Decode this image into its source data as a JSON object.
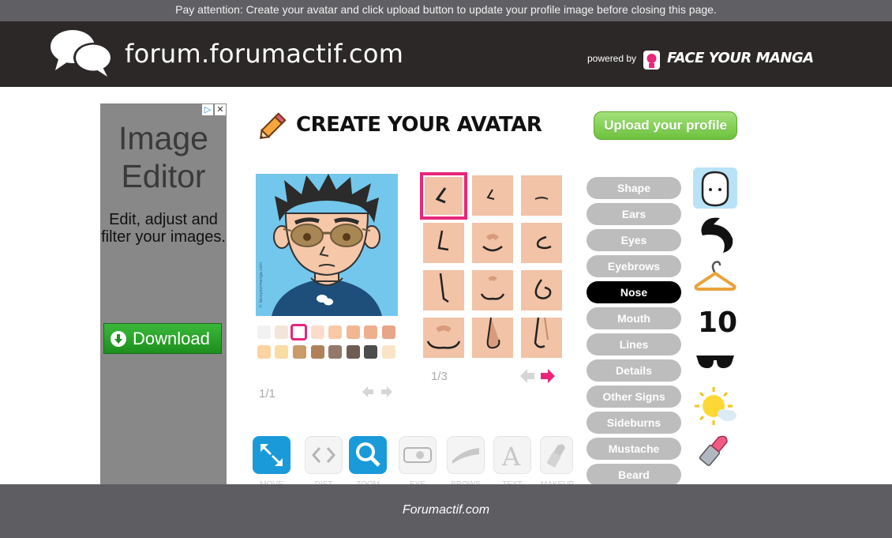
{
  "notice": "Pay attention: Create your avatar and click upload button to update your profile image before closing this page.",
  "header": {
    "site_title": "forum.forumactif.com",
    "powered_by": "powered by",
    "brand": "FACE YOUR MANGA"
  },
  "ad": {
    "title_line1": "Image",
    "title_line2": "Editor",
    "description": "Edit, adjust and filter your images.",
    "download_label": "Download"
  },
  "editor": {
    "title": "CREATE YOUR AVATAR",
    "upload_label": "Upload your profile",
    "left_page": "1/1",
    "right_page": "1/3"
  },
  "skin_swatches": [
    "#f1f1f1",
    "#f3e6d8",
    "#ffffff",
    "#fbdccb",
    "#f9c9a6",
    "#f2b693",
    "#eeaf8e",
    "#e8a58a",
    "#fbd4a2",
    "#f8dca3",
    "#c89b69",
    "#b08058",
    "#93786a",
    "#6f5c52",
    "#4d4d4d",
    "#fae4c8"
  ],
  "categories": [
    {
      "label": "Shape",
      "active": false
    },
    {
      "label": "Ears",
      "active": false
    },
    {
      "label": "Eyes",
      "active": false
    },
    {
      "label": "Eyebrows",
      "active": false
    },
    {
      "label": "Nose",
      "active": true
    },
    {
      "label": "Mouth",
      "active": false
    },
    {
      "label": "Lines",
      "active": false
    },
    {
      "label": "Details",
      "active": false
    },
    {
      "label": "Other Signs",
      "active": false
    },
    {
      "label": "Sideburns",
      "active": false
    },
    {
      "label": "Mustache",
      "active": false
    },
    {
      "label": "Beard",
      "active": false
    }
  ],
  "side_icons": [
    "face-shape-icon",
    "hair-icon",
    "hanger-icon",
    "number-10-icon",
    "sunglasses-icon",
    "sun-cloud-icon",
    "lipstick-icon"
  ],
  "tools": [
    {
      "name": "resize-tool",
      "label": "MOVE",
      "active": true
    },
    {
      "name": "distance-tool",
      "label": "DIST",
      "active": false
    },
    {
      "name": "zoom-tool",
      "label": "ZOOM",
      "active": true
    },
    {
      "name": "eye-tool",
      "label": "EYE",
      "active": false
    },
    {
      "name": "eyebrow-tool",
      "label": "BROWS",
      "active": false
    },
    {
      "name": "text-tool",
      "label": "TEXT",
      "active": false
    },
    {
      "name": "makeup-tool",
      "label": "MAKEUP",
      "active": false
    }
  ],
  "footer": "Forumactif.com",
  "colors": {
    "accent_pink": "#e8267a",
    "upload_green": "#6cc23c",
    "active_blue": "#1a9ad9"
  }
}
